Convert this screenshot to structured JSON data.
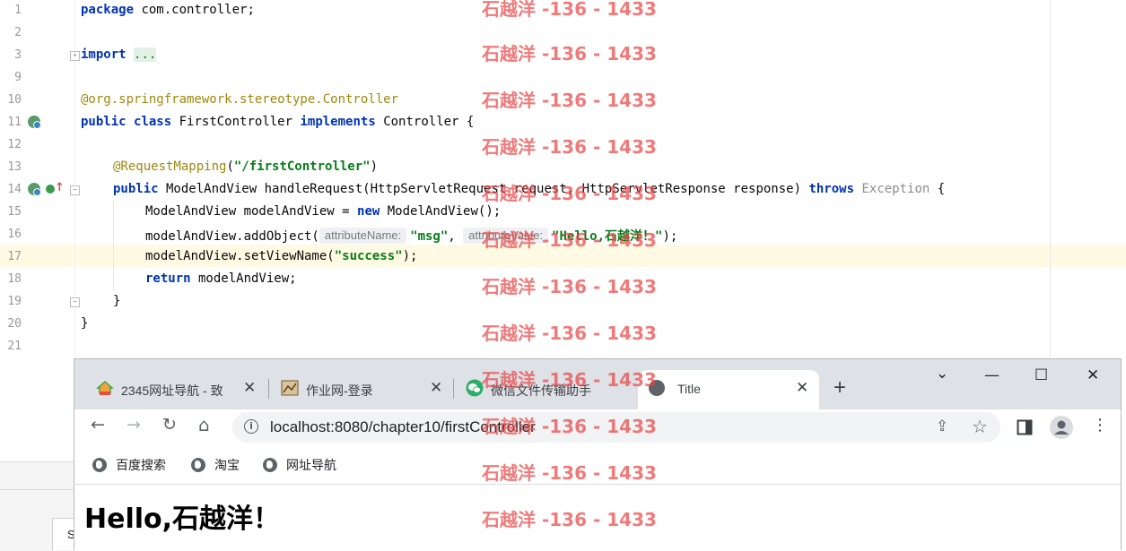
{
  "editor": {
    "lines": [
      {
        "num": "1"
      },
      {
        "num": "2"
      },
      {
        "num": "3"
      },
      {
        "num": "9"
      },
      {
        "num": "10"
      },
      {
        "num": "11"
      },
      {
        "num": "12"
      },
      {
        "num": "13"
      },
      {
        "num": "14"
      },
      {
        "num": "15"
      },
      {
        "num": "16"
      },
      {
        "num": "17"
      },
      {
        "num": "18"
      },
      {
        "num": "19"
      },
      {
        "num": "20"
      },
      {
        "num": "21"
      }
    ],
    "code": {
      "l1_kw": "package",
      "l1_rest": " com.controller;",
      "l3_kw": "import",
      "l3_fold": "...",
      "l10_at": "@org.springframework.stereotype.",
      "l10_ann": "Controller",
      "l11_kw1": "public",
      "l11_kw2": "class",
      "l11_name": " FirstController ",
      "l11_kw3": "implements",
      "l11_rest": " Controller {",
      "l13_ann": "@RequestMapping",
      "l13_open": "(",
      "l13_str": "\"/firstController\"",
      "l13_close": ")",
      "l14_kw": "public",
      "l14_mid": " ModelAndView handleRequest(HttpServletRequest request, HttpServletResponse response) ",
      "l14_kw2": "throws",
      "l14_exc": " Exception",
      "l14_brace": " {",
      "l15_pre": "ModelAndView modelAndView = ",
      "l15_kw": "new",
      "l15_post": " ModelAndView();",
      "l16_pre": "modelAndView.addObject(",
      "l16_hint1": "attributeName:",
      "l16_str1": "\"msg\"",
      "l16_comma": ", ",
      "l16_hint2": "attributeValue:",
      "l16_str2": "\"Hello,石越洋！\"",
      "l16_post": ");",
      "l17_pre": "modelAndView.setViewName(",
      "l17_str": "\"success\"",
      "l17_post": ");",
      "l18_kw": "return",
      "l18_post": " modelAndView;",
      "l19": "}",
      "l20": "}"
    },
    "bottom_tab_label": "S"
  },
  "browser": {
    "tabs": [
      {
        "title": "2345网址导航 - 致",
        "close": "✕"
      },
      {
        "title": "作业网-登录",
        "close": "✕"
      },
      {
        "title": "微信文件传输助手",
        "close": "✕"
      },
      {
        "title": "Title",
        "close": "✕"
      }
    ],
    "new_tab": "+",
    "window_controls": {
      "dropdown": "⌄",
      "minimize": "—",
      "maximize": "☐",
      "close": "✕"
    },
    "toolbar": {
      "back": "←",
      "forward": "→",
      "reload": "↻",
      "home": "⌂"
    },
    "url": "localhost:8080/chapter10/firstController",
    "info_icon": "i",
    "bookmarks": [
      {
        "label": "百度搜索"
      },
      {
        "label": "淘宝"
      },
      {
        "label": "网址导航"
      }
    ],
    "page_heading": "Hello,石越洋！"
  },
  "watermark": "石越洋 -136 - 1433",
  "colors": {
    "keyword": "#0033b3",
    "string": "#067d17",
    "annotation": "#9e880d",
    "watermark": "#e84646",
    "current_line": "#fffae3"
  }
}
